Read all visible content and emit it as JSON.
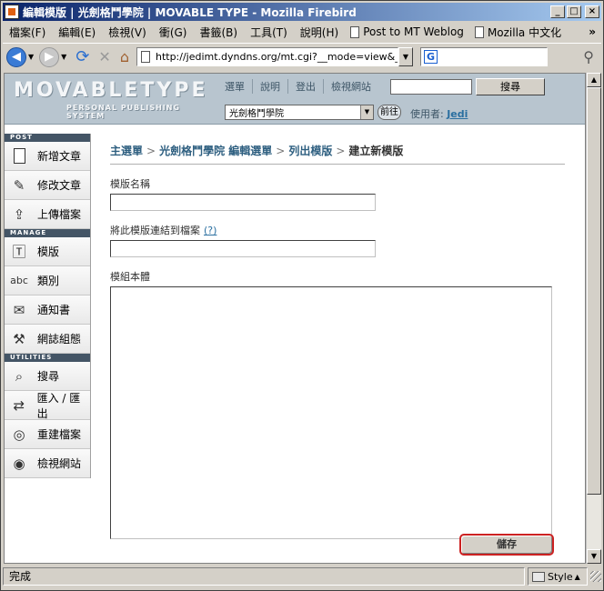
{
  "window": {
    "title": "編輯模版 | 光劍格鬥學院 | MOVABLE TYPE - Mozilla Firebird",
    "minimize": "_",
    "maximize": "□",
    "close": "×"
  },
  "menubar": {
    "items": [
      "檔案(F)",
      "編輯(E)",
      "檢視(V)",
      "衝(G)",
      "書籤(B)",
      "工具(T)",
      "說明(H)"
    ],
    "bookmarks": [
      "Post to MT Weblog",
      "Mozilla 中文化"
    ],
    "overflow": "»"
  },
  "navbar": {
    "url": "http://jedimt.dyndns.org/mt.cgi?__mode=view&_type=template",
    "search_engine": "G"
  },
  "mt": {
    "logo_main": "MOVABLETYPE",
    "logo_sub": "PERSONAL PUBLISHING SYSTEM",
    "nav": [
      "選單",
      "說明",
      "登出",
      "檢視網站"
    ],
    "search_button": "搜尋",
    "blog_selected": "光劍格鬥學院",
    "go_button": "前往",
    "user_label": "使用者:",
    "user_name": "Jedi"
  },
  "sidebar": {
    "sections": [
      {
        "head": "POST",
        "items": [
          "新增文章",
          "修改文章",
          "上傳檔案"
        ]
      },
      {
        "head": "MANAGE",
        "items": [
          "模版",
          "類別",
          "通知書",
          "網誌組態"
        ]
      },
      {
        "head": "UTILITIES",
        "items": [
          "搜尋",
          "匯入 / 匯出",
          "重建檔案",
          "檢視網站"
        ]
      }
    ]
  },
  "main": {
    "breadcrumb": [
      "主選單",
      "光劍格鬥學院 編輯選單",
      "列出模版",
      "建立新模版"
    ],
    "breadcrumb_sep": ">",
    "name_label": "模版名稱",
    "name_value": "",
    "link_label": "將此模版連結到檔案",
    "link_help": "(?)",
    "link_value": "",
    "body_label": "模組本體",
    "body_value": "",
    "save_button": "儲存"
  },
  "status": {
    "text": "完成",
    "style_label": "Style"
  }
}
